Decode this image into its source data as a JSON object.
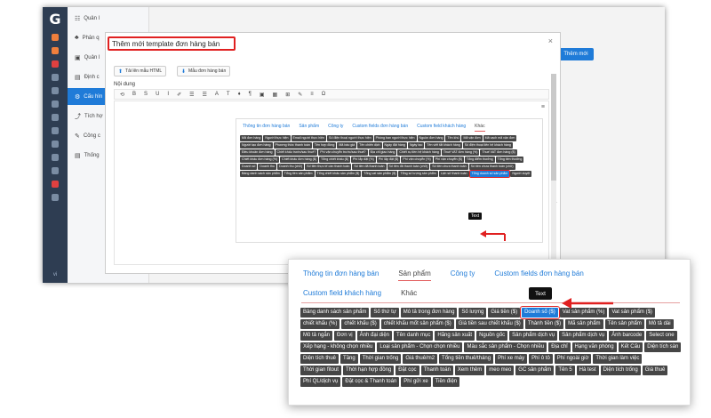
{
  "rail": {
    "logo": "G",
    "version": "vi"
  },
  "sidebar": {
    "items": [
      {
        "icon": "☷",
        "label": "Quản l"
      },
      {
        "icon": "♣",
        "label": "Phân q"
      },
      {
        "icon": "▣",
        "label": "Quản l"
      },
      {
        "icon": "▤",
        "label": "Định c"
      },
      {
        "icon": "⚙",
        "label": "Cấu hìn"
      },
      {
        "icon": "⤴",
        "label": "Tích hợ"
      },
      {
        "icon": "✎",
        "label": "Công c"
      },
      {
        "icon": "▤",
        "label": "Thống"
      }
    ]
  },
  "header": {
    "create_label": "Thêm mới"
  },
  "modal": {
    "title": "Thêm mới template đơn hàng bán",
    "close": "×",
    "download_label": "Tải lên mẫu HTML",
    "sample_label": "Mẫu đơn hàng bán",
    "content_label": "Nội dung",
    "toolbar": [
      "⟲",
      "B",
      "S",
      "U",
      "I",
      "✐",
      "☰",
      "☰",
      "A",
      "T",
      "♦",
      "¶",
      "▣",
      "▦",
      "⊞",
      "✎",
      "≡",
      "Ω"
    ],
    "editor_marker": "≡",
    "editor_hint": "DT"
  },
  "popup_small": {
    "tabs": [
      "Thông tin đơn hàng bán",
      "Sản phẩm",
      "Công ty",
      "Custom fields đơn hàng bán",
      "Custom field khách hàng",
      "Khác"
    ],
    "selected_tab": "Khác",
    "tags": [
      "Mã đơn hàng",
      "Người thực hiện",
      "Email người thực hiện",
      "Số điện thoại người thực hiện",
      "Phòng ban người thực hiện",
      "Nguồn đơn hàng",
      "Tên khú",
      "Mã vận đơn",
      "Mã vạch mã vận đơn",
      "Người tạo đơn hàng",
      "Phương thức thanh toán",
      "Tên hợp đồng",
      "Mã báo giá",
      "Tên chiến dịch",
      "Ngày đặt hàng",
      "Ngày tạo",
      "Tên viết tắt khách hàng",
      "Số điện thoại liên hệ khách hàng",
      "Điều khoản đơn hàng",
      "Chiết khấu trước/sau thuế?",
      "Phí vận chuyển trước/sau thuế?",
      "Địa chỉ giao hàng",
      "Chiết xụ tiền hệ khách hàng",
      "Thuế VAT đơn hàng (%)",
      "Thuế VAT đơn hàng ($)",
      "Chiết khấu đơn hàng (%)",
      "Chiết khấu đơn hàng ($)",
      "Tổng chiết khấu ($)",
      "Phí lắp đặt (%)",
      "Phí lắp đặt ($)",
      "Phí vận chuyển (%)",
      "Phí vận chuyển ($)",
      "Tổng điểm thưởng",
      "Tổng tiền thưởng",
      "Doanh số",
      "Doanh thu",
      "Doanh thu (chữ)",
      "Số tiền thực tế cần thanh toán",
      "Số tiền đã thanh toán",
      "Số tiền đã thanh toán (chữ)",
      "Số tiền chưa thanh toán",
      "Số tiền chưa thanh toán (chữ)",
      "Bảng danh sách sản phẩm",
      "Tổng tiền sản phẩm",
      "Tổng chiết khấu sản phẩm ($)",
      "Tổng vat sản phẩm ($)",
      "Tổng số lượng sản phẩm",
      "Lịch sử thanh toán",
      "Tổng doanh số sản phẩm",
      "Người duyệt"
    ],
    "highlight_index": 48,
    "tooltip": "Text"
  },
  "popup_zoom": {
    "tabs": [
      "Thông tin đơn hàng bán",
      "Sản phẩm",
      "Công ty",
      "Custom fields đơn hàng bán",
      "Custom field khách hàng",
      "Khác"
    ],
    "selected_tab": "Sản phẩm",
    "tags": [
      "Bảng danh sách sản phẩm",
      "Số thứ tự",
      "Mô tả trong đơn hàng",
      "Số lượng",
      "Giá tiền ($)",
      "Doanh số ($)",
      "Vat sản phẩm (%)",
      "Vat sản phẩm ($)",
      "chiết khấu (%)",
      "chiết khấu ($)",
      "chiết khấu mốt sản phẩm ($)",
      "Giá tiền sau chiết khấu ($)",
      "Thành tiền ($)",
      "Mã sản phẩm",
      "Tên sản phẩm",
      "Mô tả dài",
      "Mô tả ngắn",
      "Đơn vị",
      "Ảnh đại diện",
      "Tên danh mục",
      "Hãng sản xuất",
      "Nguồn gốc",
      "Sản phẩm dịch vụ",
      "Sản phẩm dịch vụ",
      "Ảnh barcode",
      "Select one",
      "Xếp hạng - không chọn nhiều",
      "Loại sản phẩm - Chọn chọn nhiều",
      "Màu sắc sản phẩm - Chọn nhiều",
      "Địa chỉ",
      "Hạng văn phòng",
      "Kết Cấu",
      "Diện tích sàn",
      "Diện tích thuê",
      "Tầng",
      "Thời gian trống",
      "Giá thuê/m2",
      "Tổng tiền thuê/tháng",
      "Phí xe máy",
      "Phí ô tô",
      "Phí ngoài giờ",
      "Thời gian làm việc",
      "Thời gian fitout",
      "Thời hạn hợp đồng",
      "Đặt cọc",
      "Thanh toán",
      "Xem thêm",
      "meo meo",
      "GC sản phẩm",
      "Tên 5",
      "Hà test",
      "Diện tích trống",
      "Giá thuê",
      "Phí QL/dịch vụ",
      "Đặt cọc & Thanh toán",
      "Phí gửi xe",
      "Tiền điện"
    ],
    "highlight_index": 5,
    "tooltip": "Text"
  },
  "colors": {
    "accent": "#1f7bd8",
    "highlight": "#e02020",
    "tag": "#464646",
    "rail": "#2e3d52"
  }
}
